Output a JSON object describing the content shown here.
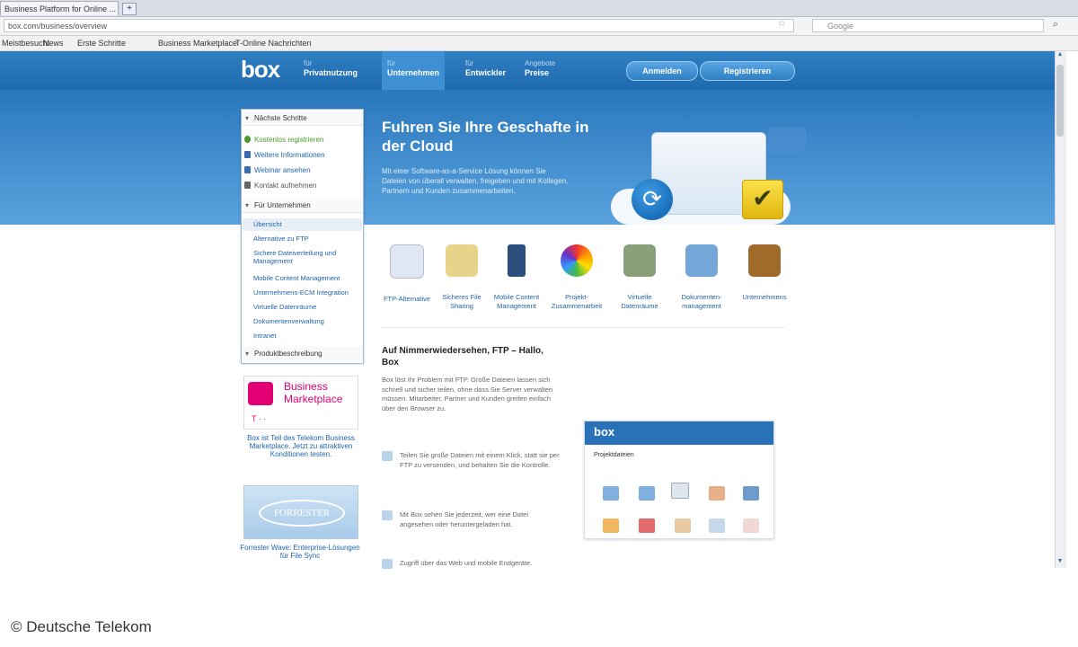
{
  "browser": {
    "tab_title": "Business Platform for Online ...",
    "new_tab": "+",
    "url": "box.com/business/overview",
    "search_placeholder": "Google",
    "bookmarks": [
      "Meistbesucht",
      "News",
      "Erste Schritte",
      "Business Marketplace",
      "T-Online Nachrichten"
    ]
  },
  "site": {
    "logo": "box",
    "nav": [
      {
        "small": "für",
        "label": "Privatnutzung"
      },
      {
        "small": "für",
        "label": "Unternehmen"
      },
      {
        "small": "für",
        "label": "Entwickler"
      },
      {
        "small": "Angebote",
        "label": "Preise"
      }
    ],
    "login_button": "Anmelden",
    "register_button": "Registrieren",
    "hero_title": "Fuhren Sie Ihre Geschafte in der Cloud",
    "hero_text": "Mit einer Software-as-a-Service Lösung können Sie Dateien von überall verwalten, freigeben und mit Kollegen, Partnern und Kunden zusammenarbeiten."
  },
  "sidebar": {
    "section1": "Nächste Schritte",
    "items1": [
      "Kostenlos registrieren",
      "Weitere Informationen",
      "Webinar ansehen",
      "Kontakt aufnehmen"
    ],
    "section2": "Für Unternehmen",
    "items2": [
      "Übersicht",
      "Alternative zu FTP",
      "Sichere Dateiverteilung und Management",
      "Mobile Content Management",
      "Unternehmens-ECM Integration",
      "Virtuelle Datenräume",
      "Dokumentenverwaltung",
      "Intranet"
    ],
    "section3": "Produktbeschreibung"
  },
  "ads": {
    "ad1_title": "Business Marketplace",
    "ad1_logo": "T · ·",
    "ad1_text": "Box ist Teil des Telekom Business Marketplace. Jetzt zu attraktiven Konditionen testen.",
    "ad2_title": "FORRESTER",
    "ad2_text": "Forrester Wave: Enterprise-Lösungen für File Sync"
  },
  "features": [
    {
      "label": "FTP-Alternative",
      "color": "#dfe8f2"
    },
    {
      "label": "Sicheres File Sharing",
      "color": "#e8d38a"
    },
    {
      "label": "Mobile Content Management",
      "color": "#2b4e7d"
    },
    {
      "label": "Projekt-Zusammenarbeit",
      "color": "#f07a3a"
    },
    {
      "label": "Virtuelle Datenräume",
      "color": "#8aa07a"
    },
    {
      "label": "Dokumenten-management",
      "color": "#74a7d8"
    },
    {
      "label": "Unternehmens",
      "color": "#a06a2a"
    }
  ],
  "content": {
    "title": "Auf Nimmerwiedersehen, FTP – Hallo, Box",
    "paragraph": "Box löst Ihr Problem mit FTP. Große Dateien lassen sich schnell und sicher teilen, ohne dass Sie Server verwalten müssen. Mitarbeiter, Partner und Kunden greifen einfach über den Browser zu.",
    "bullets": [
      "Teilen Sie große Dateien mit einem Klick, statt sie per FTP zu versenden, und behalten Sie die Kontrolle.",
      "Mit Box sehen Sie jederzeit, wer eine Datei angesehen oder heruntergeladen hat.",
      "Zugriff über das Web und mobile Endgeräte."
    ]
  },
  "preview": {
    "logo": "box",
    "folder": "Projektdateien"
  },
  "watermark": "© Deutsche Telekom"
}
